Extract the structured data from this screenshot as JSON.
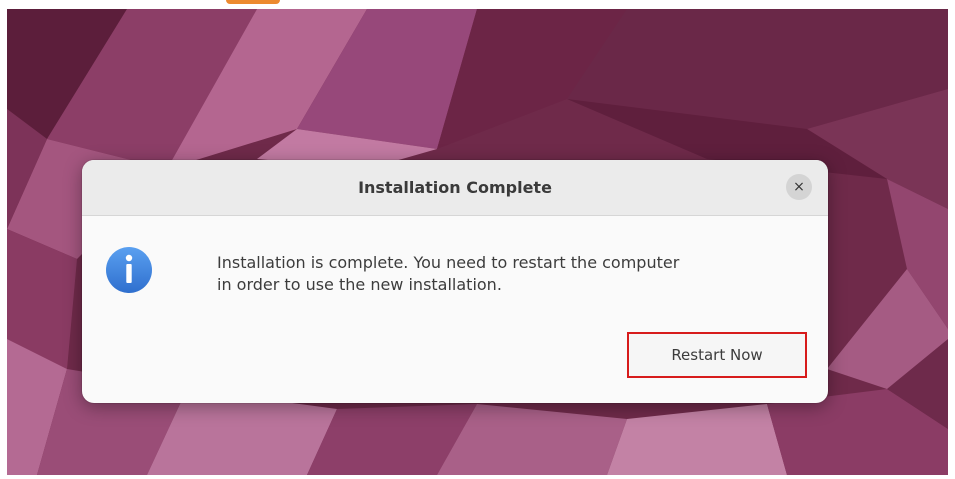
{
  "dialog": {
    "title": "Installation Complete",
    "close_label": "×",
    "message_line1": "Installation is complete. You need to restart the computer",
    "message_line2": "in order to use the new installation.",
    "restart_button": "Restart Now",
    "info_icon_name": "info-icon"
  },
  "colors": {
    "wallpaper_base": "#6f2a4a",
    "wallpaper_light": "#b7618f",
    "wallpaper_dark": "#4d1732",
    "dialog_bg": "#fafafa",
    "titlebar_bg": "#ebebeb",
    "info_icon_blue": "#3f82e0",
    "highlight_border": "#d71b1b",
    "orange_fragment": "#ec8a2f"
  }
}
